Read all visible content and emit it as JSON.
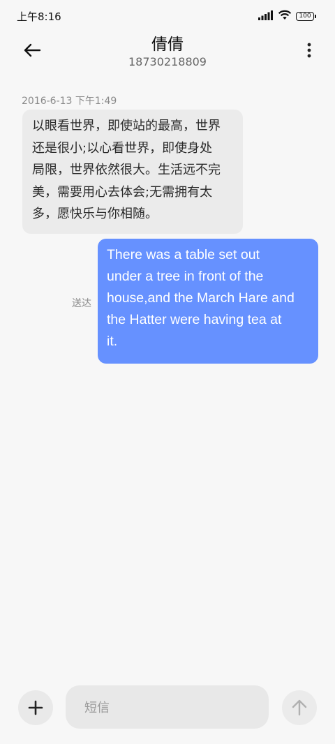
{
  "status_bar": {
    "time": "上午8:16",
    "battery": "100",
    "icons": [
      "signal-icon",
      "wifi-icon",
      "battery-icon"
    ]
  },
  "header": {
    "contact_name": "倩倩",
    "phone_number": "18730218809",
    "icons": [
      "back-arrow-icon",
      "more-vert-icon"
    ]
  },
  "messages": [
    {
      "direction": "incoming",
      "timestamp": "2016-6-13 下午1:49",
      "lines": [
        "以眼看世界，即使站的最高，世界",
        "还是很小;以心看世界，即使身处",
        "局限，世界依然很大。生活远不完",
        "美，需要用心去体会;无需拥有太",
        "多，愿快乐与你相随。"
      ]
    },
    {
      "direction": "outgoing",
      "status": "送达",
      "lines": [
        "There was a table set out",
        "under a tree in front of the",
        "house,and the March Hare and",
        "the Hatter were having tea at",
        "it."
      ]
    }
  ],
  "composer": {
    "placeholder": "短信",
    "icons": [
      "plus-icon",
      "send-arrow-icon"
    ]
  },
  "colors": {
    "background": "#f7f7f7",
    "incoming_bubble": "#ebebeb",
    "outgoing_bubble": "#6691ff"
  }
}
